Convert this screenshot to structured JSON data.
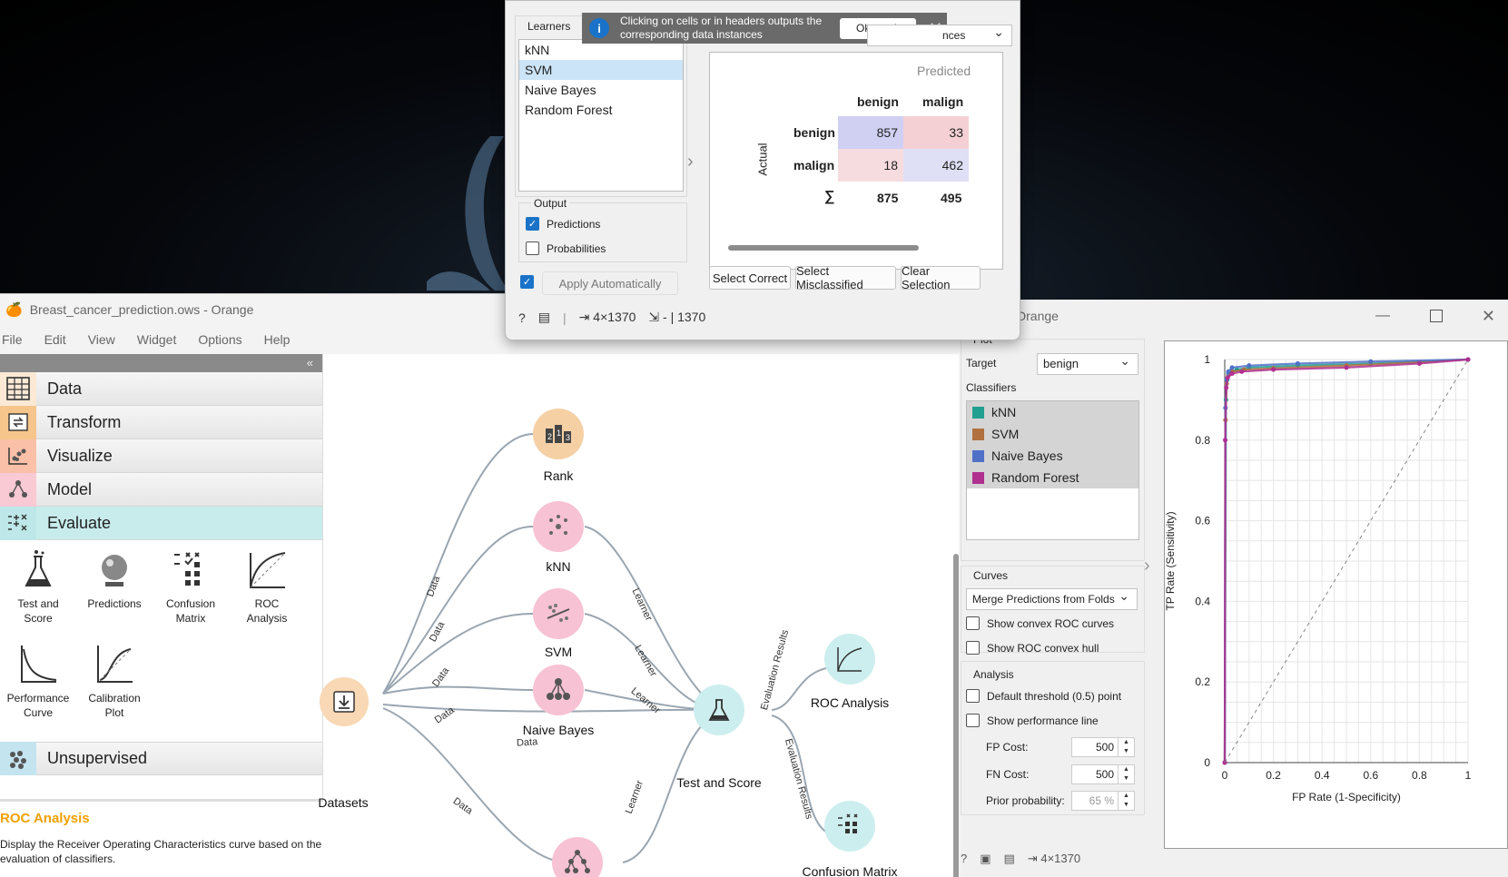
{
  "main_window": {
    "title": "Breast_cancer_prediction.ows - Orange",
    "menu": [
      "File",
      "Edit",
      "View",
      "Widget",
      "Options",
      "Help"
    ],
    "collapse_label": "«",
    "categories": [
      {
        "label": "Data",
        "icon": "table-icon",
        "color": "#fbe9d6"
      },
      {
        "label": "Transform",
        "icon": "transform-icon",
        "color": "#f6c58b"
      },
      {
        "label": "Visualize",
        "icon": "scatter-icon",
        "color": "#fbc0a8"
      },
      {
        "label": "Model",
        "icon": "tree-icon",
        "color": "#f9c9d4"
      },
      {
        "label": "Evaluate",
        "icon": "evaluate-icon",
        "color": "#bde7e8"
      },
      {
        "label": "Unsupervised",
        "icon": "cluster-icon",
        "color": "#c4e4f0"
      }
    ],
    "tools": [
      {
        "label": "Test and\nScore",
        "icon": "flask-icon"
      },
      {
        "label": "Predictions",
        "icon": "crystal-ball-icon"
      },
      {
        "label": "Confusion\nMatrix",
        "icon": "confusion-matrix-icon"
      },
      {
        "label": "ROC\nAnalysis",
        "icon": "roc-curve-icon"
      },
      {
        "label": "Performance\nCurve",
        "icon": "performance-curve-icon"
      },
      {
        "label": "Calibration\nPlot",
        "icon": "calibration-plot-icon"
      }
    ],
    "help": {
      "title": "ROC Analysis",
      "text": "Display the Receiver Operating Characteristics curve based on the evaluation of classifiers."
    }
  },
  "workflow": {
    "nodes": [
      {
        "id": "rank",
        "label": "Rank",
        "color": "#f5d0a5",
        "icon": "rank-icon"
      },
      {
        "id": "knn",
        "label": "kNN",
        "color": "#f7c2d3",
        "icon": "knn-icon"
      },
      {
        "id": "svm",
        "label": "SVM",
        "color": "#f7c2d3",
        "icon": "svm-icon"
      },
      {
        "id": "nb",
        "label": "Naive Bayes",
        "color": "#f7c2d3",
        "icon": "naive-bayes-icon"
      },
      {
        "id": "datasets",
        "label": "Datasets",
        "color": "#f8d8b5",
        "icon": "download-icon"
      },
      {
        "id": "tas",
        "label": "Test and Score",
        "color": "#cdeeee",
        "icon": "flask-icon"
      },
      {
        "id": "roc",
        "label": "ROC Analysis",
        "color": "#cdeeee",
        "icon": "roc-curve-icon"
      },
      {
        "id": "cm",
        "label": "Confusion Matrix",
        "color": "#cdeeee",
        "icon": "confusion-matrix-icon"
      },
      {
        "id": "rf",
        "label": "",
        "color": "#f7c2d3",
        "icon": "random-forest-icon"
      }
    ],
    "edge_labels": {
      "data": "Data",
      "learner": "Learner",
      "eval": "Evaluation Results"
    }
  },
  "confusion_dialog": {
    "learners_title": "Learners",
    "learners": [
      "kNN",
      "SVM",
      "Naive Bayes",
      "Random Forest"
    ],
    "selected_learner": "SVM",
    "notice_text": "Clicking on cells or in headers outputs the corresponding data instances",
    "notice_button": "Ok, got it",
    "show_combo": "nces",
    "predicted_label": "Predicted",
    "actual_label": "Actual",
    "classes": [
      "benign",
      "malign"
    ],
    "matrix": [
      [
        857,
        33
      ],
      [
        18,
        462
      ]
    ],
    "sum_symbol": "∑",
    "col_sums": [
      875,
      495
    ],
    "output_title": "Output",
    "predictions_label": "Predictions",
    "predictions_checked": true,
    "probabilities_label": "Probabilities",
    "probabilities_checked": false,
    "apply_label": "Apply Automatically",
    "buttons": [
      "Select Correct",
      "Select Misclassified",
      "Clear Selection"
    ],
    "status_in": "4×1370",
    "status_out": "- | 1370"
  },
  "roc_window": {
    "title": "nalysis - Orange",
    "plot_title": "Plot",
    "target_label": "Target",
    "target_value": "benign",
    "classifiers_label": "Classifiers",
    "classifiers": [
      {
        "name": "kNN",
        "color": "#20a090"
      },
      {
        "name": "SVM",
        "color": "#b07040"
      },
      {
        "name": "Naive Bayes",
        "color": "#5070c8"
      },
      {
        "name": "Random Forest",
        "color": "#b03090"
      }
    ],
    "curves_label": "Curves",
    "curves_value": "Merge Predictions from Folds",
    "convex_curves": "Show convex ROC curves",
    "convex_hull": "Show ROC convex hull",
    "analysis_label": "Analysis",
    "default_threshold": "Default threshold (0.5) point",
    "perf_line": "Show performance line",
    "fp_cost_label": "FP Cost:",
    "fp_cost": "500",
    "fn_cost_label": "FN Cost:",
    "fn_cost": "500",
    "prior_label": "Prior probability:",
    "prior_value": "65 %",
    "status_in": "4×1370"
  },
  "chart_data": {
    "type": "line",
    "xlabel": "FP Rate (1-Specificity)",
    "ylabel": "TP Rate (Sensitivity)",
    "xlim": [
      0,
      1
    ],
    "ylim": [
      0,
      1
    ],
    "xticks": [
      "0",
      "0.2",
      "0.4",
      "0.6",
      "0.8",
      "1"
    ],
    "yticks": [
      "0",
      "0.2",
      "0.4",
      "0.6",
      "0.8",
      "1"
    ],
    "grid": true,
    "series": [
      {
        "name": "kNN",
        "color": "#20a090",
        "x": [
          0,
          0.005,
          0.01,
          0.015,
          0.02,
          0.05,
          0.1,
          0.3,
          0.6,
          1
        ],
        "y": [
          0,
          0.9,
          0.95,
          0.965,
          0.97,
          0.975,
          0.98,
          0.985,
          0.99,
          1
        ]
      },
      {
        "name": "SVM",
        "color": "#b07040",
        "x": [
          0,
          0.003,
          0.008,
          0.015,
          0.03,
          0.08,
          0.2,
          0.5,
          0.8,
          1
        ],
        "y": [
          0,
          0.85,
          0.94,
          0.96,
          0.97,
          0.975,
          0.978,
          0.985,
          0.993,
          1
        ]
      },
      {
        "name": "Naive Bayes",
        "color": "#5070c8",
        "x": [
          0,
          0.003,
          0.008,
          0.015,
          0.03,
          0.1,
          0.3,
          0.6,
          1
        ],
        "y": [
          0,
          0.88,
          0.95,
          0.97,
          0.98,
          0.985,
          0.99,
          0.995,
          1
        ]
      },
      {
        "name": "Random Forest",
        "color": "#b03090",
        "x": [
          0,
          0.002,
          0.006,
          0.012,
          0.03,
          0.07,
          0.2,
          0.5,
          0.8,
          1
        ],
        "y": [
          0,
          0.8,
          0.93,
          0.955,
          0.965,
          0.97,
          0.975,
          0.98,
          0.99,
          1
        ]
      },
      {
        "name": "",
        "color": "#888888",
        "dashed": true,
        "x": [
          0,
          1
        ],
        "y": [
          0,
          1
        ]
      }
    ]
  }
}
